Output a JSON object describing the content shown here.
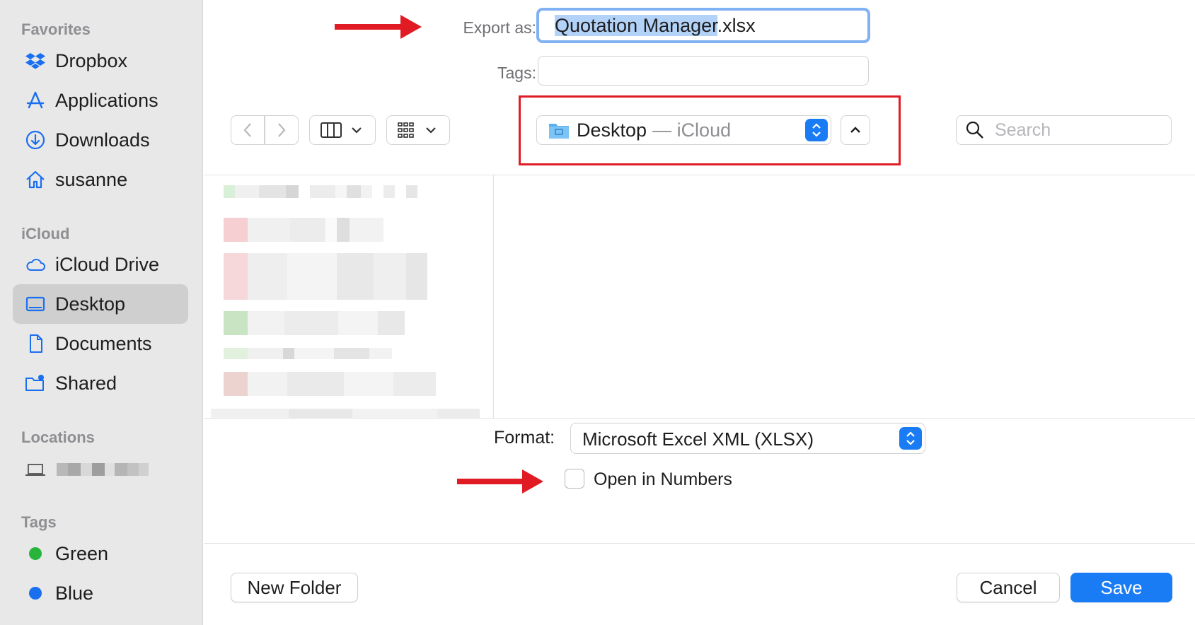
{
  "sidebar": {
    "sections": {
      "favorites": "Favorites",
      "icloud": "iCloud",
      "locations": "Locations",
      "tags": "Tags"
    },
    "favorites": [
      {
        "label": "Dropbox",
        "icon": "dropbox-icon"
      },
      {
        "label": "Applications",
        "icon": "applications-icon"
      },
      {
        "label": "Downloads",
        "icon": "downloads-icon"
      },
      {
        "label": "susanne",
        "icon": "home-icon"
      }
    ],
    "icloud": [
      {
        "label": "iCloud Drive",
        "icon": "cloud-icon"
      },
      {
        "label": "Desktop",
        "icon": "desktop-icon",
        "selected": true
      },
      {
        "label": "Documents",
        "icon": "document-icon"
      },
      {
        "label": "Shared",
        "icon": "shared-folder-icon"
      }
    ],
    "locations": [
      {
        "icon": "laptop-icon"
      }
    ],
    "tags": [
      {
        "label": "Green",
        "color": "#28b43c"
      },
      {
        "label": "Blue",
        "color": "#1a6ff0"
      }
    ]
  },
  "dialog": {
    "export_label": "Export as:",
    "filename_selected": "Quotation Manager",
    "filename_ext": ".xlsx",
    "tags_label": "Tags:",
    "location_name": "Desktop",
    "location_suffix": "— iCloud",
    "search_placeholder": "Search",
    "format_label": "Format:",
    "format_value": "Microsoft Excel XML (XLSX)",
    "open_in_numbers_label": "Open in Numbers",
    "open_in_numbers_checked": false,
    "new_folder_label": "New Folder",
    "cancel_label": "Cancel",
    "save_label": "Save"
  },
  "colors": {
    "accent": "#1a7cf5",
    "annotation_red": "#e01b24"
  }
}
